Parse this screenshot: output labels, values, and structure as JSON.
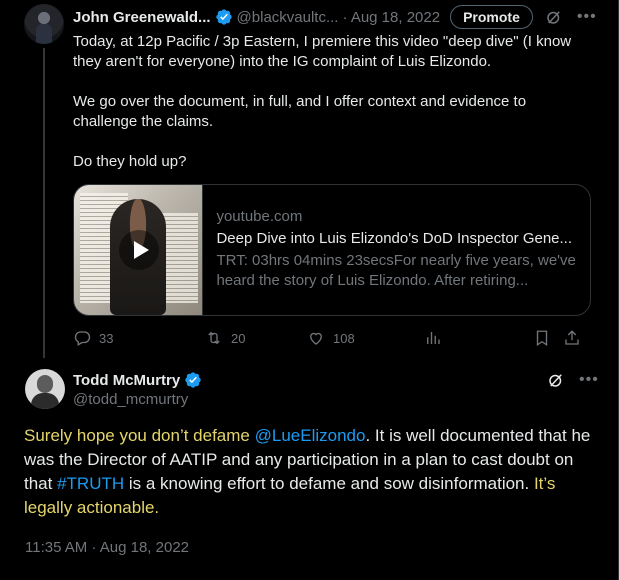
{
  "tweet1": {
    "author_name": "John Greenewald...",
    "author_handle": "@blackvaultc...",
    "date": "· Aug 18, 2022",
    "promote_label": "Promote",
    "text": "Today, at 12p Pacific / 3p Eastern, I premiere this video \"deep dive\" (I know they aren't for everyone) into the IG complaint of Luis Elizondo.\n\nWe go over the document, in full, and I offer context and evidence to challenge the claims.\n\nDo they hold up?",
    "card": {
      "domain": "youtube.com",
      "title": "Deep Dive into Luis Elizondo's DoD Inspector Gene...",
      "description": "TRT: 03hrs 04mins 23secsFor nearly five years, we've heard the story of Luis Elizondo. After retiring..."
    },
    "replies": "33",
    "retweets": "20",
    "likes": "108"
  },
  "tweet2": {
    "author_name": "Todd McMurtry",
    "author_handle": "@todd_mcmurtry",
    "text_part1": "Surely hope you don’t defame ",
    "mention": "@LueElizondo",
    "text_part2": ". It is well documented that he was the Director of AATIP and any participation in a plan to cast doubt on that ",
    "hashtag": "#TRUTH",
    "text_part3": " is a knowing effort to defame and sow disinformation. ",
    "text_part4": "It’s legally actionable.",
    "timestamp": "11:35 AM · Aug 18, 2022"
  },
  "colors": {
    "background": "#000000",
    "text": "#e7e9ea",
    "muted": "#71767b",
    "link": "#1d9bf0",
    "highlight": "#e4d56b",
    "verified": "#1d9bf0"
  },
  "icons": [
    "verified-badge-icon",
    "grok-icon",
    "more-icon",
    "play-icon",
    "reply-icon",
    "retweet-icon",
    "like-icon",
    "views-icon",
    "bookmark-icon",
    "share-icon"
  ]
}
